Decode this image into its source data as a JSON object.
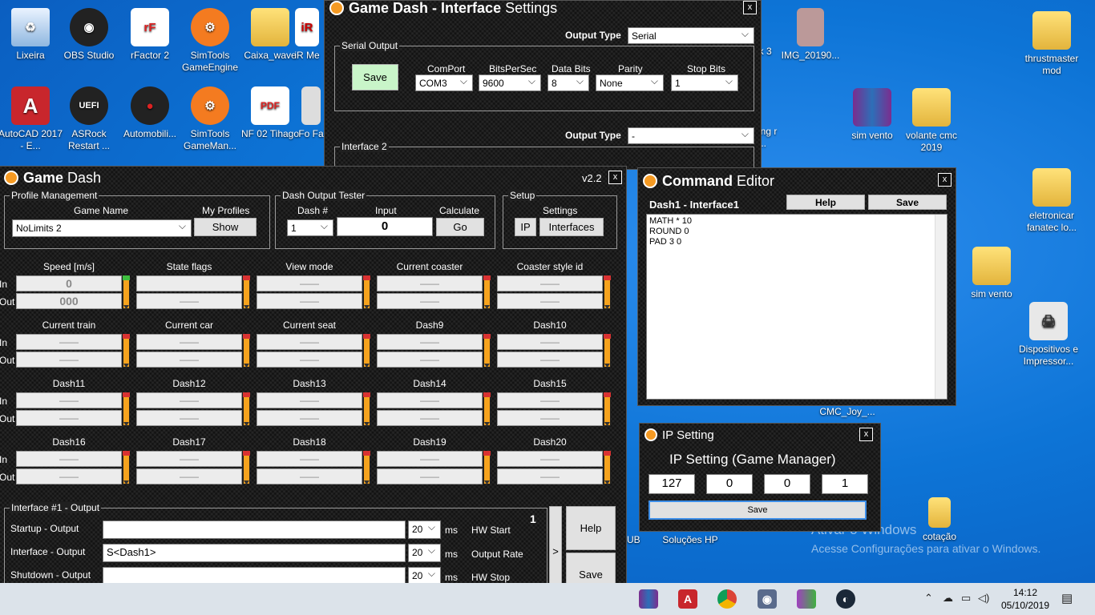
{
  "desktop": {
    "icons": [
      "Lixeira",
      "OBS Studio",
      "rFactor 2",
      "SimTools GameEngine",
      "Caixa_wave",
      "iR Me",
      "AutoCAD 2017 - E...",
      "ASRock Restart ...",
      "Automobili...",
      "SimTools GameMan...",
      "NF 02 Tihago",
      "Fo Fa",
      "ak 3",
      "IMG_20190...",
      "thrustmaster mod",
      "ing r ...",
      "sim vento",
      "volante cmc 2019",
      "eletronicar fanatec lo...",
      "sim vento",
      "Dispositivos e Impressor...",
      "CMC_Joy_...",
      "Soluções HP",
      "cotação",
      "UB"
    ],
    "watermark": {
      "line1": "Ativar o Windows",
      "line2": "Acesse Configurações para ativar o Windows."
    }
  },
  "interface_settings": {
    "title_normal": "Game Dash - ",
    "title_bold": "Interface",
    "title_rest": " Settings",
    "output_type_label": "Output Type",
    "output_type_value": "Serial",
    "serial_group": "Serial Output",
    "save": "Save",
    "comport_label": "ComPort",
    "comport_value": "COM3",
    "bits_label": "BitsPerSec",
    "bits_value": "9600",
    "databits_label": "Data Bits",
    "databits_value": "8",
    "parity_label": "Parity",
    "parity_value": "None",
    "stopbits_label": "Stop Bits",
    "stopbits_value": "1",
    "output_type2_label": "Output Type",
    "output_type2_value": "-",
    "interface2_group": "Interface 2",
    "close": "x"
  },
  "game_dash": {
    "title_bold": "Game",
    "title_rest": " Dash",
    "version": "v2.2",
    "close": "x",
    "profile_group": "Profile Management",
    "game_name_label": "Game Name",
    "game_name_value": "NoLimits 2",
    "my_profiles_label": "My Profiles",
    "show": "Show",
    "tester_group": "Dash Output Tester",
    "dash_no_label": "Dash #",
    "dash_no_value": "1",
    "input_label": "Input",
    "input_value": "0",
    "calculate_label": "Calculate",
    "go": "Go",
    "setup_group": "Setup",
    "settings_label": "Settings",
    "ip": "IP",
    "interfaces": "Interfaces",
    "in_label": "In",
    "out_label": "Out",
    "dashes": [
      {
        "name": "Speed [m/s]",
        "in": "0",
        "out": "000",
        "active": true
      },
      {
        "name": "State flags",
        "in": "",
        "out": "——"
      },
      {
        "name": "View mode",
        "in": "——",
        "out": "——"
      },
      {
        "name": "Current coaster",
        "in": "——",
        "out": "——"
      },
      {
        "name": "Coaster style id",
        "in": "——",
        "out": "——"
      },
      {
        "name": "Current train",
        "in": "——",
        "out": "——"
      },
      {
        "name": "Current car",
        "in": "——",
        "out": "——"
      },
      {
        "name": "Current seat",
        "in": "——",
        "out": "——"
      },
      {
        "name": "Dash9",
        "in": "——",
        "out": "——"
      },
      {
        "name": "Dash10",
        "in": "——",
        "out": "——"
      },
      {
        "name": "Dash11",
        "in": "——",
        "out": "——"
      },
      {
        "name": "Dash12",
        "in": "——",
        "out": "——"
      },
      {
        "name": "Dash13",
        "in": "——",
        "out": "——"
      },
      {
        "name": "Dash14",
        "in": "——",
        "out": "——"
      },
      {
        "name": "Dash15",
        "in": "——",
        "out": "——"
      },
      {
        "name": "Dash16",
        "in": "——",
        "out": "——"
      },
      {
        "name": "Dash17",
        "in": "——",
        "out": "——"
      },
      {
        "name": "Dash18",
        "in": "——",
        "out": "——"
      },
      {
        "name": "Dash19",
        "in": "——",
        "out": "——"
      },
      {
        "name": "Dash20",
        "in": "——",
        "out": "——"
      }
    ],
    "interface_group": "Interface #1 - Output",
    "interface_number": "1",
    "startup_label": "Startup - Output",
    "startup_value": "",
    "interface_label": "Interface - Output",
    "interface_value": "S<Dash1>",
    "shutdown_label": "Shutdown - Output",
    "shutdown_value": "",
    "ms_value": "20",
    "ms": "ms",
    "hw_start": "HW Start",
    "output_rate": "Output Rate",
    "hw_stop": "HW Stop",
    "arrow": ">",
    "help": "Help",
    "save": "Save"
  },
  "command_editor": {
    "title_bold": "Command",
    "title_rest": " Editor",
    "close": "x",
    "subtitle": "Dash1 - Interface1",
    "help": "Help",
    "save": "Save",
    "lines": [
      "MATH * 10",
      "ROUND 0",
      "PAD 3 0"
    ]
  },
  "ip_setting": {
    "title": "IP Setting",
    "close": "x",
    "heading": "IP Setting (Game Manager)",
    "octets": [
      "127",
      "0",
      "0",
      "1"
    ],
    "save": "Save"
  },
  "taskbar": {
    "time": "14:12",
    "date": "05/10/2019"
  }
}
